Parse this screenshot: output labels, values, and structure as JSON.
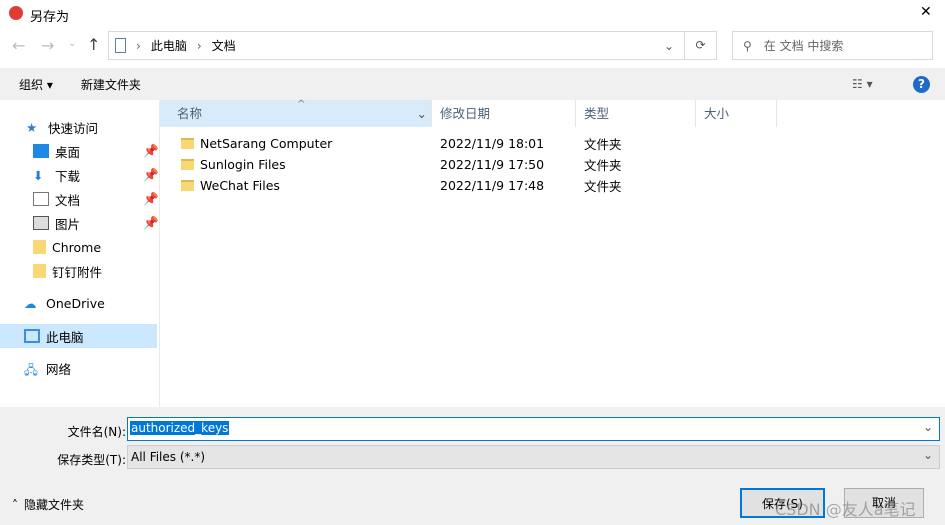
{
  "window": {
    "title": "另存为",
    "close": "✕"
  },
  "address": {
    "path": [
      "此电脑",
      "文档"
    ],
    "search_placeholder": "在 文档 中搜索"
  },
  "toolbar": {
    "organize": "组织 ▾",
    "new_folder": "新建文件夹",
    "help": "?"
  },
  "nav": {
    "items": [
      {
        "label": "快速访问",
        "icon": "star-icon"
      },
      {
        "label": "桌面",
        "icon": "desktop-icon",
        "pinned": true
      },
      {
        "label": "下载",
        "icon": "download-icon",
        "pinned": true
      },
      {
        "label": "文档",
        "icon": "document-icon",
        "pinned": true
      },
      {
        "label": "图片",
        "icon": "picture-icon",
        "pinned": true
      },
      {
        "label": "Chrome",
        "icon": "folder-icon"
      },
      {
        "label": "钉钉附件",
        "icon": "folder-icon"
      },
      {
        "label": "OneDrive",
        "icon": "cloud-icon"
      },
      {
        "label": "此电脑",
        "icon": "computer-icon",
        "selected": true
      },
      {
        "label": "网络",
        "icon": "network-icon"
      }
    ]
  },
  "columns": [
    "名称",
    "修改日期",
    "类型",
    "大小"
  ],
  "files": [
    {
      "name": "NetSarang Computer",
      "date": "2022/11/9 18:01",
      "type": "文件夹"
    },
    {
      "name": "Sunlogin Files",
      "date": "2022/11/9 17:50",
      "type": "文件夹"
    },
    {
      "name": "WeChat Files",
      "date": "2022/11/9 17:48",
      "type": "文件夹"
    }
  ],
  "form": {
    "filename_label": "文件名(N):",
    "filename": "authorized_keys",
    "type_label": "保存类型(T):",
    "type": "All Files (*.*)"
  },
  "footer": {
    "hide_folders": "隐藏文件夹",
    "save": "保存(S)",
    "cancel": "取消"
  },
  "watermark": "CSDN @友人a笔记",
  "colors": {
    "accent": "#0078d7",
    "selected_nav": "#cce8ff",
    "header_hover": "#d9ebf9"
  }
}
